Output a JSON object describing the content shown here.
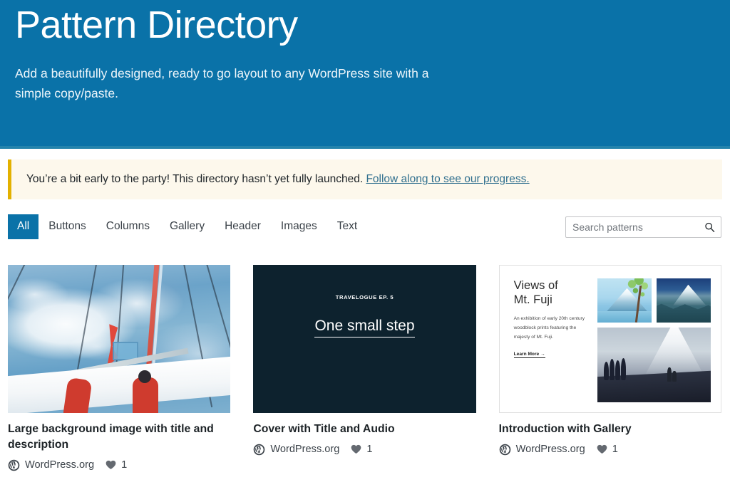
{
  "hero": {
    "title": "Pattern Directory",
    "subtitle": "Add a beautifully designed, ready to go layout to any WordPress site with a simple copy/paste.",
    "background_color": "#0a72a8"
  },
  "notice": {
    "text": "You’re a bit early to the party! This directory hasn’t yet fully launched. ",
    "link_text": "Follow along to see our progress.",
    "background_color": "#fdf8ec",
    "accent_color": "#e3b100"
  },
  "filters": {
    "tabs": [
      {
        "label": "All",
        "active": true
      },
      {
        "label": "Buttons",
        "active": false
      },
      {
        "label": "Columns",
        "active": false
      },
      {
        "label": "Gallery",
        "active": false
      },
      {
        "label": "Header",
        "active": false
      },
      {
        "label": "Images",
        "active": false
      },
      {
        "label": "Text",
        "active": false
      }
    ],
    "active_color": "#0a72a8"
  },
  "search": {
    "placeholder": "Search patterns",
    "value": "",
    "icon": "search-icon"
  },
  "patterns": [
    {
      "title": "Large background image with title and description",
      "author": "WordPress.org",
      "favorites": "1",
      "preview_type": "watercolor-sailboat-photo"
    },
    {
      "title": "Cover with Title and Audio",
      "author": "WordPress.org",
      "favorites": "1",
      "preview_type": "dark-cover",
      "preview": {
        "eyebrow": "TRAVELOGUE EP. 5",
        "heading": "One small step",
        "background_color": "#0d222e"
      }
    },
    {
      "title": "Introduction with Gallery",
      "author": "WordPress.org",
      "favorites": "1",
      "preview_type": "fuji-gallery",
      "preview": {
        "heading_line1": "Views of",
        "heading_line2": "Mt. Fuji",
        "body": "An exhibition of early 20th century woodblock prints featuring the majesty of Mt. Fuji.",
        "link": "Learn More →"
      }
    }
  ],
  "icons": {
    "wordpress": "wordpress-logo-icon",
    "heart": "heart-icon"
  }
}
